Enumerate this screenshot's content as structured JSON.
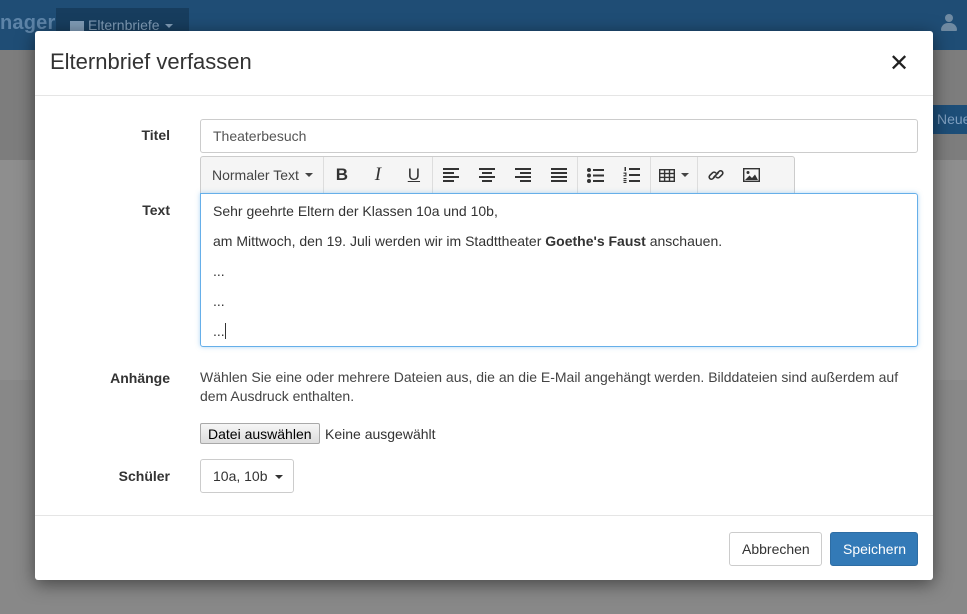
{
  "background": {
    "brand": "nager",
    "nav_item": "Elternbriefe",
    "new_button": "Neue"
  },
  "modal": {
    "title": "Elternbrief verfassen",
    "close_symbol": "✕"
  },
  "form": {
    "title_label": "Titel",
    "title_value": "Theaterbesuch",
    "text_label": "Text",
    "toolbar": {
      "style_dropdown": "Normaler Text",
      "bold": "B",
      "italic": "I",
      "underline": "U",
      "icons": [
        "align-left-icon",
        "align-center-icon",
        "align-right-icon",
        "align-justify-icon",
        "bullet-list-icon",
        "numbered-list-icon",
        "table-icon",
        "link-icon",
        "image-icon"
      ]
    },
    "editor": {
      "line1": "Sehr geehrte Eltern der Klassen 10a und 10b,",
      "line2_before": "am Mittwoch, den 19. Juli werden wir im Stadttheater ",
      "line2_bold": "Goethe's Faust",
      "line2_after": " anschauen.",
      "line3": "...",
      "line4": "...",
      "line5": "..."
    },
    "attachments_label": "Anhänge",
    "attachments_help": "Wählen Sie eine oder mehrere Dateien aus, die an die E-Mail angehängt werden. Bilddateien sind außerdem auf dem Ausdruck enthalten.",
    "file_button": "Datei auswählen",
    "file_status": "Keine ausgewählt",
    "students_label": "Schüler",
    "students_value": "10a, 10b"
  },
  "footer": {
    "cancel": "Abbrechen",
    "save": "Speichern"
  },
  "colors": {
    "primary": "#337ab7",
    "focus_border": "#66afe9",
    "navbar": "#1f4d75"
  }
}
